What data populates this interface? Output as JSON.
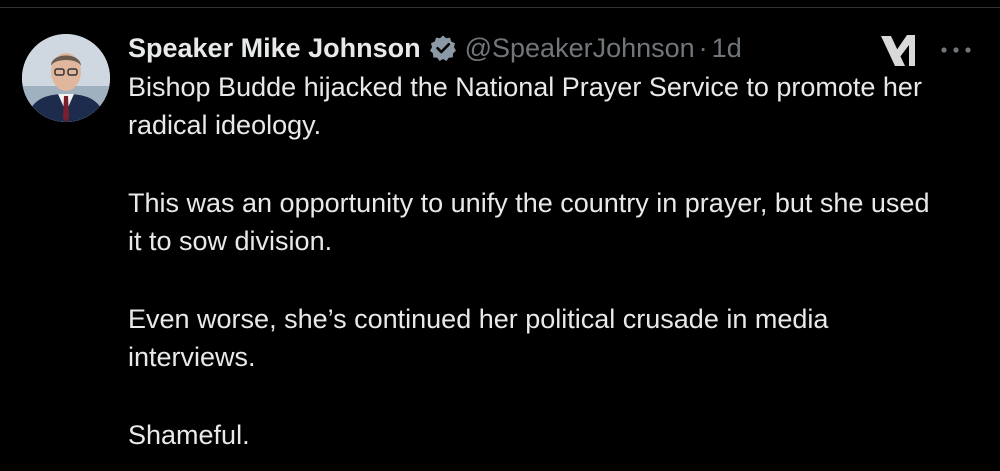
{
  "author": {
    "display_name": "Speaker Mike Johnson",
    "handle": "@SpeakerJohnson",
    "separator": "·",
    "timestamp": "1d"
  },
  "icons": {
    "verified": "verified-badge-icon",
    "grok": "grok-icon",
    "more": "more-options-icon"
  },
  "colors": {
    "background": "#000000",
    "text_primary": "#e7e9ea",
    "text_secondary": "#71767b"
  },
  "tweet": {
    "paragraphs": [
      "Bishop Budde hijacked the National Prayer Service to promote her radical ideology.",
      "This was an opportunity to unify the country in prayer, but she used it to sow division.",
      "Even worse, she’s continued her political crusade in media interviews.",
      "Shameful."
    ]
  }
}
